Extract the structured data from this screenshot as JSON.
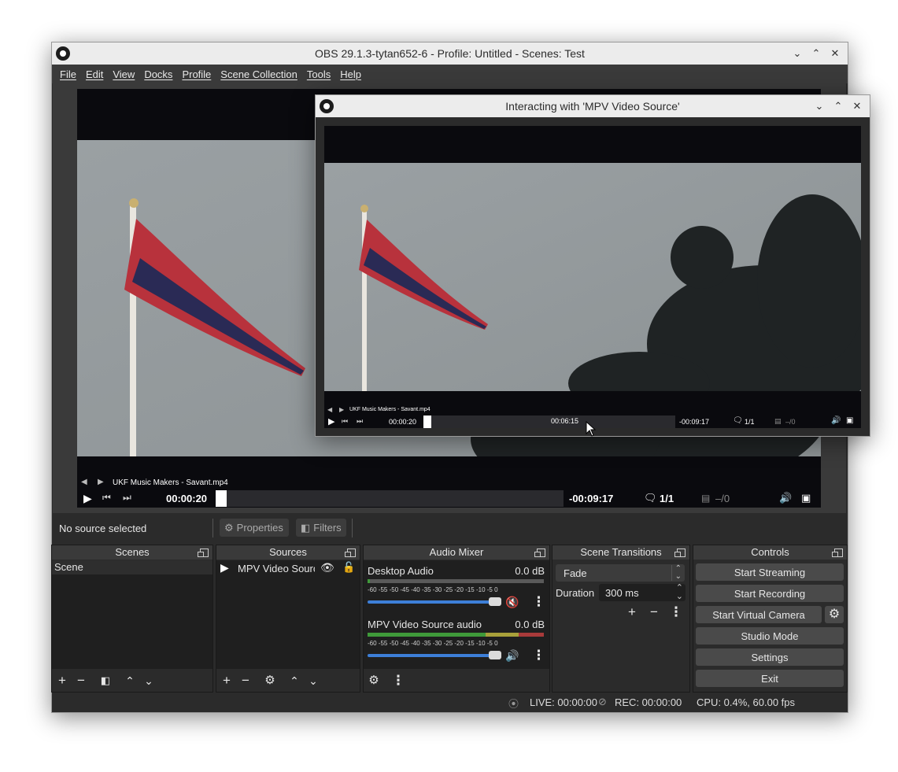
{
  "main_window": {
    "title": "OBS 29.1.3-tytan652-6 - Profile: Untitled - Scenes: Test",
    "menus": [
      "File",
      "Edit",
      "View",
      "Docks",
      "Profile",
      "Scene Collection",
      "Tools",
      "Help"
    ]
  },
  "preview": {
    "media_title": "UKF Music Makers - Savant.mp4",
    "time_current": "00:00:20",
    "time_remaining": "-00:09:17",
    "chat": "1/1",
    "subs": "–/0",
    "progress": 0.035
  },
  "source_toolbar": {
    "no_source": "No source selected",
    "properties": "Properties",
    "filters": "Filters"
  },
  "scenes": {
    "title": "Scenes",
    "items": [
      "Scene"
    ]
  },
  "sources": {
    "title": "Sources",
    "items": [
      "MPV Video Source"
    ]
  },
  "audio_mixer": {
    "title": "Audio Mixer",
    "channels": [
      {
        "name": "Desktop Audio",
        "db": "0.0 dB",
        "muted": true,
        "volume": 1.0
      },
      {
        "name": "MPV Video Source audio",
        "db": "0.0 dB",
        "muted": false,
        "volume": 1.0
      }
    ],
    "scale": [
      "-60",
      "-55",
      "-50",
      "-45",
      "-40",
      "-35",
      "-30",
      "-25",
      "-20",
      "-15",
      "-10",
      "-5",
      "0"
    ]
  },
  "transitions": {
    "title": "Scene Transitions",
    "selected": "Fade",
    "duration_label": "Duration",
    "duration_value": "300 ms"
  },
  "controls": {
    "title": "Controls",
    "buttons": [
      "Start Streaming",
      "Start Recording",
      "Start Virtual Camera",
      "Studio Mode",
      "Settings",
      "Exit"
    ]
  },
  "status": {
    "live": "LIVE: 00:00:00",
    "rec": "REC: 00:00:00",
    "cpu": "CPU: 0.4%, 60.00 fps"
  },
  "interact_window": {
    "title": "Interacting with 'MPV Video Source'",
    "media_title": "UKF Music Makers - Savant.mp4",
    "time_current": "00:00:20",
    "hover_time": "00:06:15",
    "time_remaining": "-00:09:17",
    "chat": "1/1",
    "subs": "–/0"
  },
  "colors": {
    "accent_blue": "#3d7fd8",
    "mute_red": "#d0364a",
    "meter_green": "#3f9a3a",
    "meter_yellow": "#a8a03a",
    "meter_red": "#a83a3a"
  }
}
